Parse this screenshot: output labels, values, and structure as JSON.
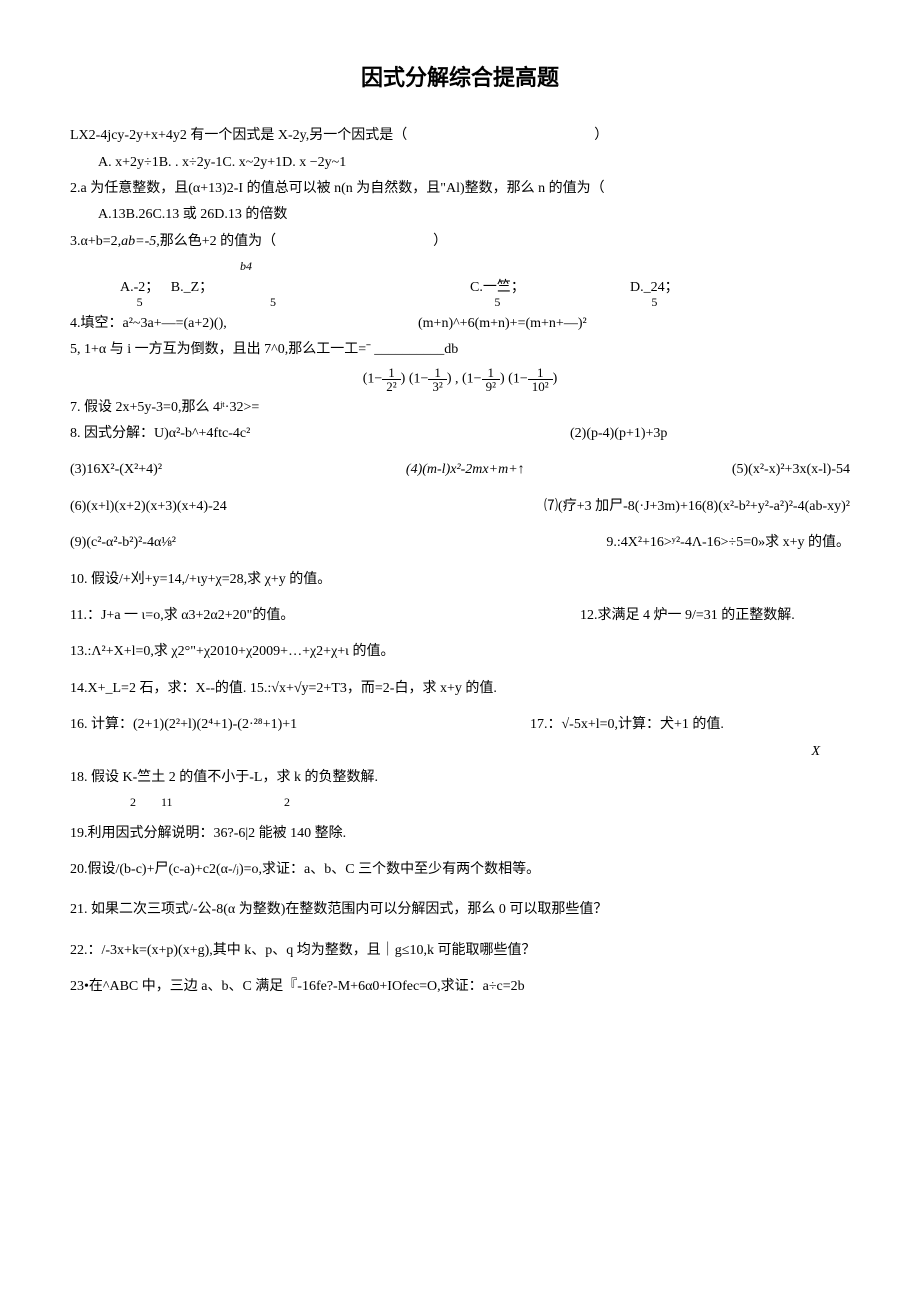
{
  "title": "因式分解综合提高题",
  "q1": {
    "stem": "LX2-4jcy-2y+x+4y2 有一个因式是 X-2y,另一个因式是（",
    "tail": "）",
    "opts": "A. x+2y÷1B. . x÷2y-1C. x~2y+1D. x −2y~1"
  },
  "q2": {
    "stem": "2.a 为任意整数，且(α+13)2-I 的值总可以被 n(n 为自然数，且\"Al)整数，那么 n 的值为（",
    "opts": "A.13B.26C.13 或 26D.13 的倍数"
  },
  "q3": {
    "stem_a": "3.α+b=2,",
    "stem_b": "ab=-5,",
    "stem_c": "那么色+2 的值为（",
    "tail": "）",
    "sub": "b4",
    "A_top": "A.-2；",
    "A_bot": "5",
    "B_top": "B._Z；",
    "B_bot": "5",
    "C_top": "C.一竺；",
    "C_bot": "5",
    "D_top": "D._24；",
    "D_bot": "5"
  },
  "q4": {
    "left": "4.填空：a²~3a+—=(a+2)(),",
    "right": "(m+n)^+6(m+n)+=(m+n+—)²"
  },
  "q5": "5, 1+α 与 i 一方互为倒数，且出 7^0,那么工一工=ˉ __________db",
  "formula_parts": [
    "1−",
    "1",
    "2²",
    "1−",
    "1",
    "3²",
    ",",
    "1−",
    "1",
    "9²",
    "1−",
    "1",
    "10²"
  ],
  "q7": "7. 假设 2x+5y-3=0,那么 4ʲᵗ·32>=",
  "q8": {
    "left": "8. 因式分解：U)α²-b^+4ftc-4c²",
    "right": "(2)(p-4)(p+1)+3p"
  },
  "q8row2": {
    "a": "(3)16X²-(X²+4)²",
    "b": "(4)(m-l)x²-2mx+m+↑",
    "c": "(5)(x²-x)²+3x(x-l)-54"
  },
  "q8row3": {
    "a": "(6)(x+l)(x+2)(x+3)(x+4)-24",
    "b": "⑺(疗+3 加尸-8(·J+3m)+16(8)(x²-b²+y²-a²)²-4(ab-xy)²"
  },
  "q8row4": {
    "a": "(9)(c²-α²-b²)²-4α⅛²",
    "b": "9.:4X²+16>ʸ²-4Λ-16>÷5=0»求 x+y 的值。"
  },
  "q10": "10. 假设/+刈+y=14,/+ιy+χ=28,求 χ+y 的值。",
  "q11": {
    "a": "11.：J+a 一 ι=o,求 α3+2α2+20\"的值。",
    "b": "12.求满足 4 炉一 9/=31 的正整数解."
  },
  "q13": "13.:Λ²+X+l=0,求 χ2°\"+χ2010+χ2009+…+χ2+χ+ι 的值。",
  "q14": "14.X+_L=2 石，求：X--的值. 15.:√x+√y=2+T3，而=2-白，求 x+y 的值.",
  "q16": {
    "a": "16. 计算：(2+1)(2²+l)(2⁴+1)-(2·²⁸+1)+1",
    "b": "17.：√-5x+l=0,计算：犬+1 的值."
  },
  "floatX": "X",
  "q18": {
    "top_a": "18. 假设 K-竺土 2 的值不小于-L，求 k 的负整数解.",
    "bot_a": "2",
    "bot_b": "11",
    "bot_c": "2"
  },
  "q19": "19.利用因式分解说明：36?-6|2 能被 140 整除.",
  "q20": "20.假设/(b-c)+尸(c-a)+c2(α-/ⱼ)=o,求证：a、b、C 三个数中至少有两个数相等。",
  "q21": "21. 如果二次三项式/-公-8(α 为整数)在整数范围内可以分解因式，那么 0 可以取那些值？",
  "q22": "22.：/-3x+k=(x+p)(x+g),其中 k、p、q 均为整数，且｜g≤10,k 可能取哪些值？",
  "q23": "23•在^ABC 中，三边 a、b、C 满足『-16fe?-M+6α0+IOfec=O,求证：a÷c=2b"
}
